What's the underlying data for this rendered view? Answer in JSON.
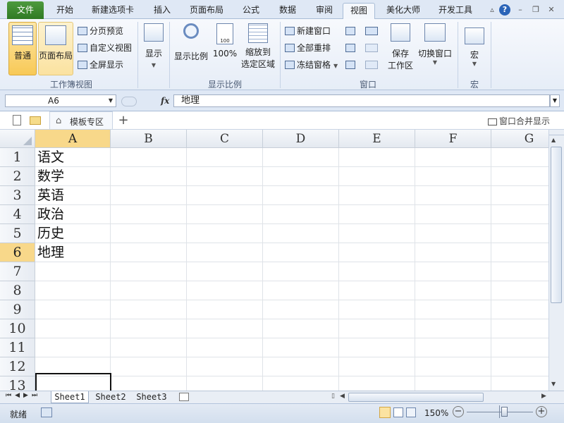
{
  "tabs": {
    "file": "文件",
    "home": "开始",
    "new_tab": "新建选项卡",
    "insert": "插入",
    "page_layout": "页面布局",
    "formulas": "公式",
    "data": "数据",
    "review": "审阅",
    "view": "视图",
    "beautify": "美化大师",
    "developer": "开发工具"
  },
  "ribbon": {
    "workbook_views": {
      "title": "工作簿视图",
      "normal": "普通",
      "page_layout": "页面布局",
      "page_break_preview": "分页预览",
      "custom_views": "自定义视图",
      "full_screen": "全屏显示"
    },
    "show": {
      "label": "显示"
    },
    "zoom": {
      "title": "显示比例",
      "zoom": "显示比例",
      "zoom_100": "100%",
      "zoom_selection_line1": "缩放到",
      "zoom_selection_line2": "选定区域"
    },
    "window": {
      "title": "窗口",
      "new_window": "新建窗口",
      "arrange_all": "全部重排",
      "freeze_panes": "冻结窗格",
      "save_line1": "保存",
      "save_line2": "工作区",
      "switch_windows": "切换窗口"
    },
    "macros": {
      "title": "宏",
      "macros": "宏"
    }
  },
  "formula_bar": {
    "name_box": "A6",
    "fx": "fx",
    "content": "地理"
  },
  "doc_tabs": {
    "template_zone": "模板专区",
    "add": "+",
    "merge_windows": "窗口合并显示"
  },
  "grid": {
    "columns": [
      "A",
      "B",
      "C",
      "D",
      "E",
      "F",
      "G"
    ],
    "rows": [
      "1",
      "2",
      "3",
      "4",
      "5",
      "6",
      "7",
      "8",
      "9",
      "10",
      "11",
      "12",
      "13"
    ],
    "cells_a": [
      "语文",
      "数学",
      "英语",
      "政治",
      "历史",
      "地理",
      "",
      "",
      "",
      "",
      "",
      "",
      ""
    ],
    "selected_cell": "A6"
  },
  "sheets": [
    "Sheet1",
    "Sheet2",
    "Sheet3"
  ],
  "status": {
    "ready": "就绪",
    "zoom": "150%"
  },
  "colors": {
    "accent": "#4d9a3e",
    "selection_header": "#f8d88a"
  }
}
